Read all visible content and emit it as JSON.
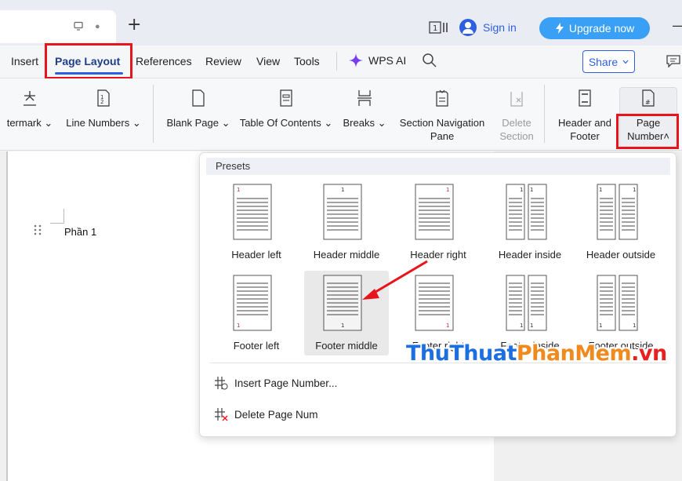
{
  "titlebar": {
    "add_tab": "+",
    "sign_in": "Sign in",
    "upgrade": "Upgrade now",
    "minimize": "—"
  },
  "tabs": {
    "insert": "Insert",
    "page_layout": "Page Layout",
    "references": "References",
    "review": "Review",
    "view": "View",
    "tools": "Tools",
    "wps_ai": "WPS AI",
    "share": "Share"
  },
  "ribbon": {
    "watermark": "termark",
    "line_numbers": "Line Numbers",
    "blank_page": "Blank Page",
    "toc": "Table Of Contents",
    "breaks": "Breaks",
    "section_nav_1": "Section Navigation",
    "section_nav_2": "Pane",
    "delete_section_1": "Delete",
    "delete_section_2": "Section",
    "header_footer_1": "Header and",
    "header_footer_2": "Footer",
    "page_number_1": "Page",
    "page_number_2": "Number"
  },
  "document": {
    "heading": "Phần 1"
  },
  "dropdown": {
    "presets_label": "Presets",
    "presets": [
      {
        "label": "Header left"
      },
      {
        "label": "Header middle"
      },
      {
        "label": "Header right"
      },
      {
        "label": "Header inside"
      },
      {
        "label": "Header outside"
      },
      {
        "label": "Footer left"
      },
      {
        "label": "Footer middle"
      },
      {
        "label": "Footer right"
      },
      {
        "label": "Footer inside"
      },
      {
        "label": "Footer outside"
      }
    ],
    "insert_page_number": "Insert Page Number...",
    "delete_page_num": "Delete Page Num"
  },
  "watermark": {
    "part1": "ThuThuat",
    "part2": "PhanMem",
    "part3": ".vn"
  },
  "colors": {
    "accent": "#2d5fe0",
    "highlight_red": "#e8141b",
    "upgrade_bg": "#3aa0f5"
  }
}
